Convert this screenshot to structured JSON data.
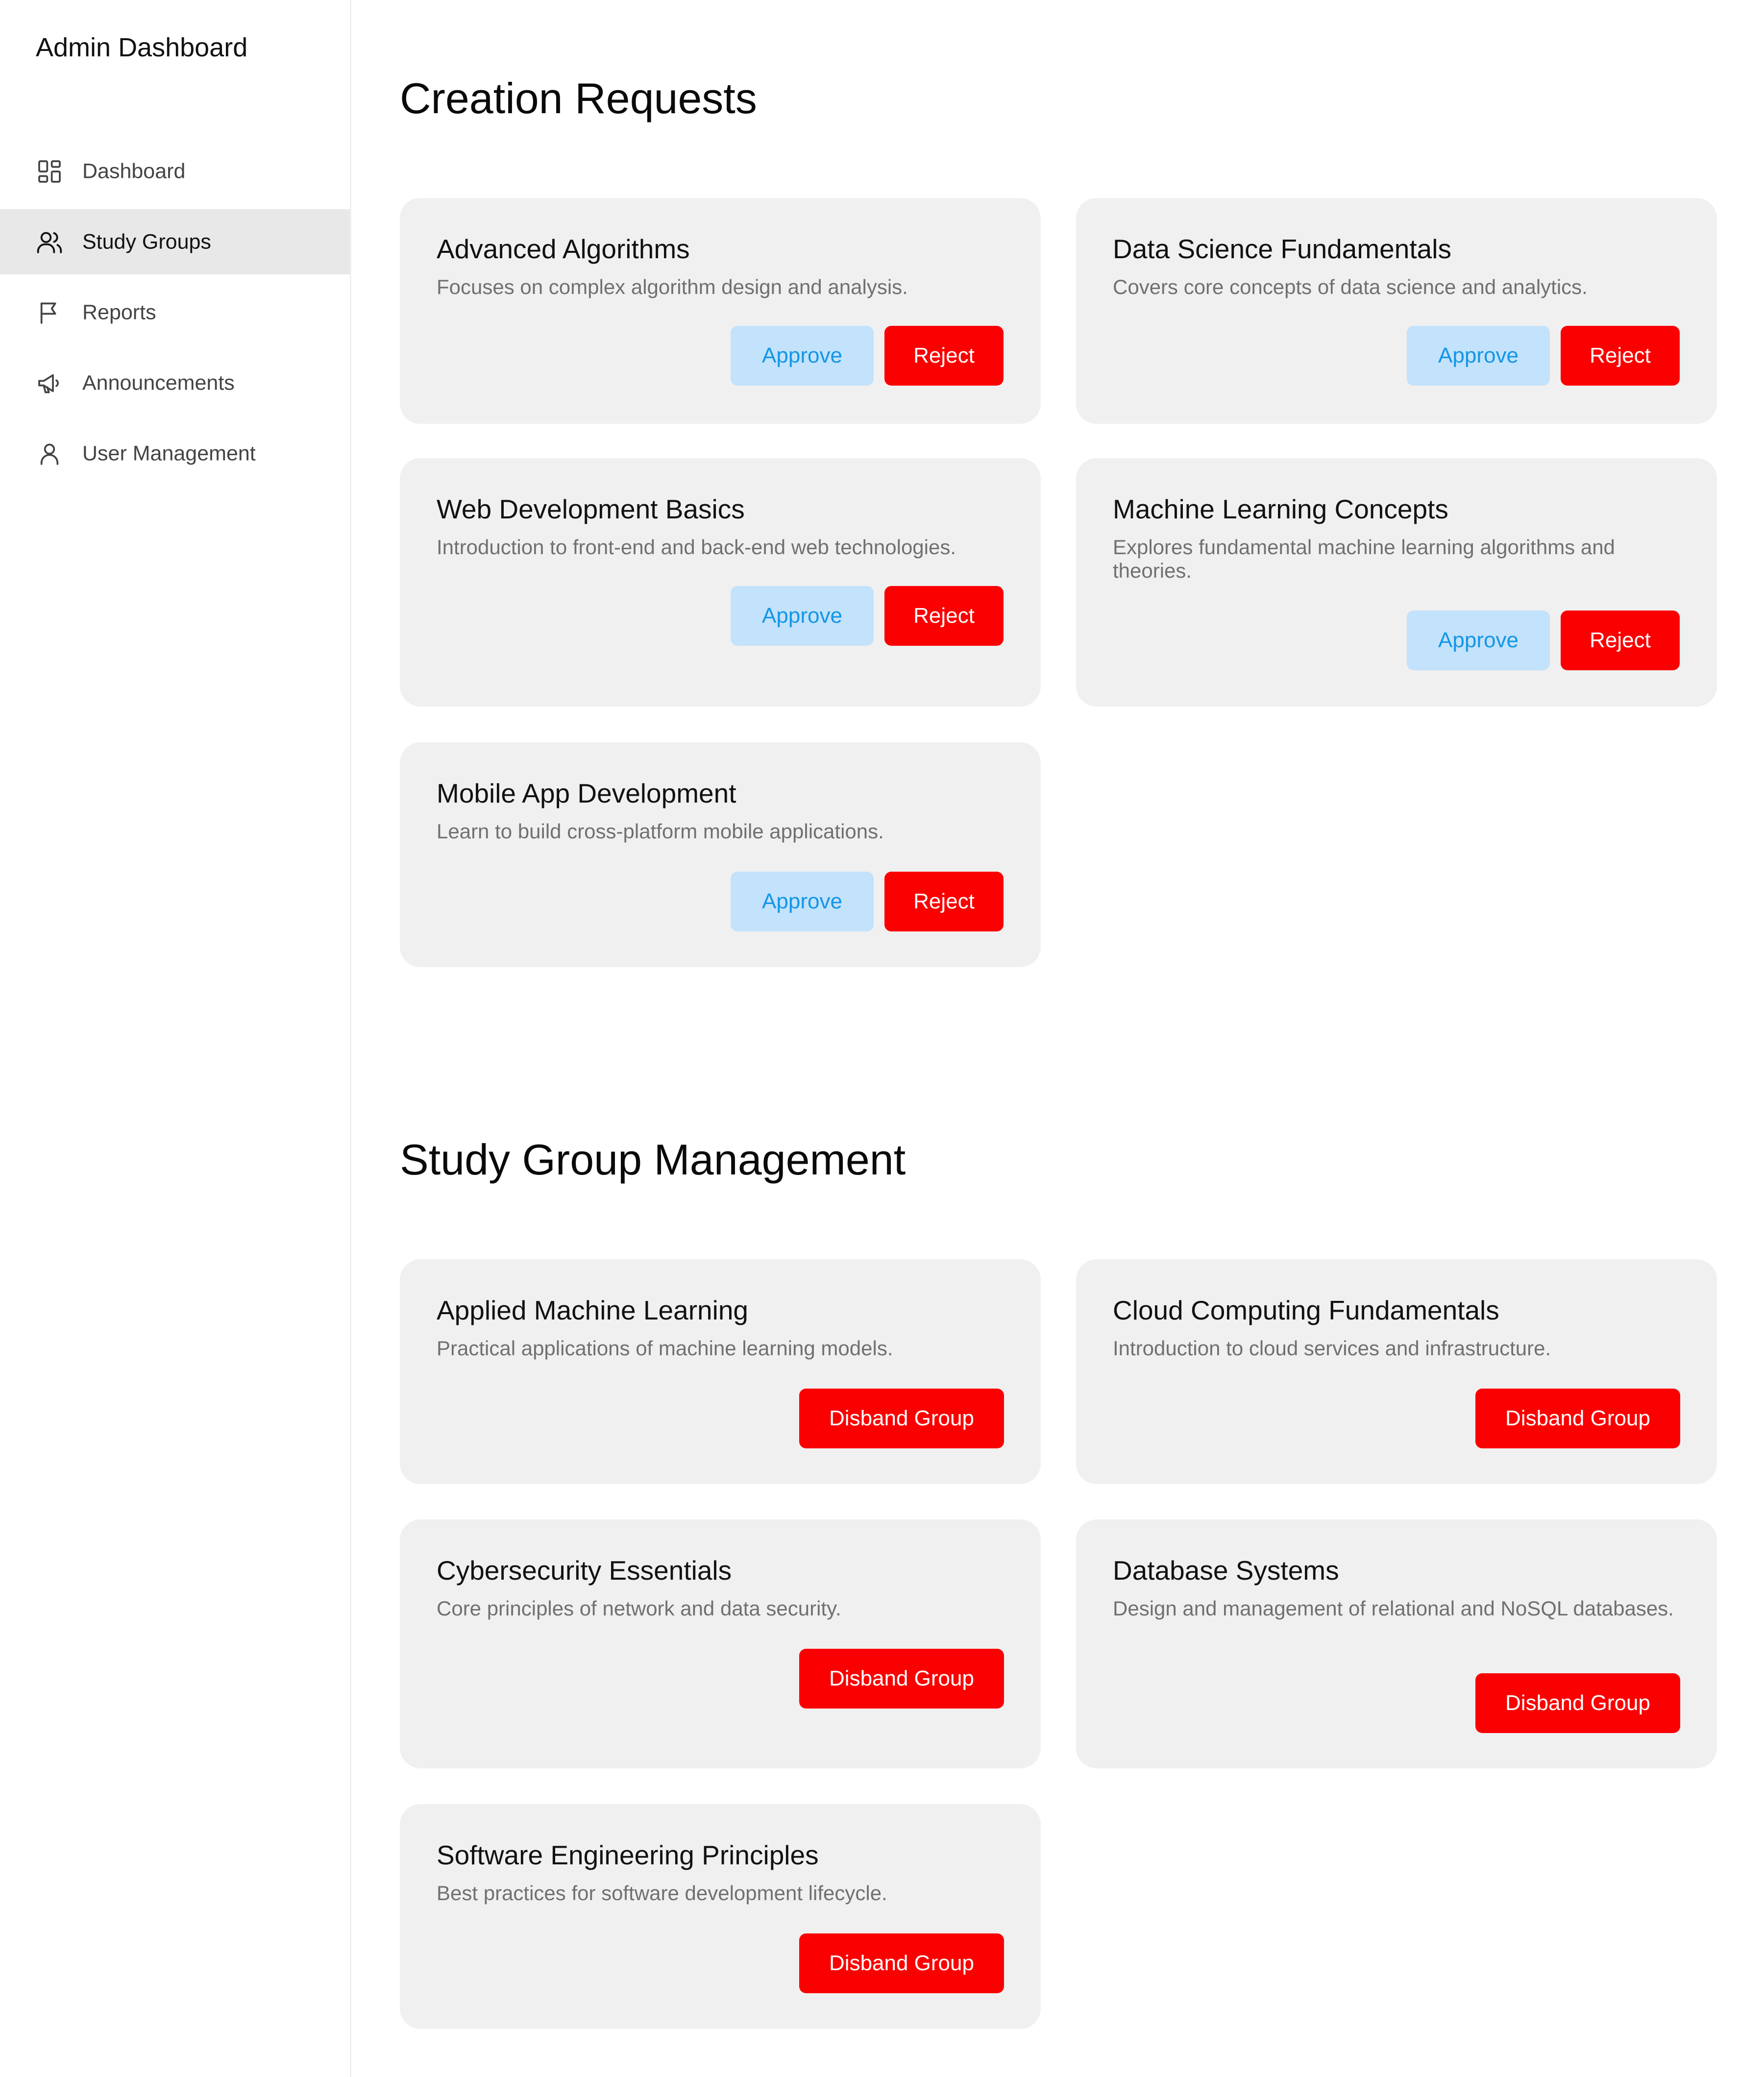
{
  "sidebar": {
    "title": "Admin Dashboard",
    "items": [
      {
        "label": "Dashboard",
        "icon": "dashboard-icon"
      },
      {
        "label": "Study Groups",
        "icon": "users-icon",
        "active": true
      },
      {
        "label": "Reports",
        "icon": "flag-icon"
      },
      {
        "label": "Announcements",
        "icon": "megaphone-icon"
      },
      {
        "label": "User Management",
        "icon": "user-icon"
      }
    ]
  },
  "creation_requests": {
    "title": "Creation Requests",
    "approve_label": "Approve",
    "reject_label": "Reject",
    "cards": [
      {
        "title": "Advanced Algorithms",
        "description": "Focuses on complex algorithm design and analysis."
      },
      {
        "title": "Data Science Fundamentals",
        "description": "Covers core concepts of data science and analytics."
      },
      {
        "title": "Web Development Basics",
        "description": "Introduction to front-end and back-end web technologies."
      },
      {
        "title": "Machine Learning Concepts",
        "description": "Explores fundamental machine learning algorithms and theories."
      },
      {
        "title": "Mobile App Development",
        "description": "Learn to build cross-platform mobile applications."
      }
    ]
  },
  "management": {
    "title": "Study Group Management",
    "disband_label": "Disband Group",
    "cards": [
      {
        "title": "Applied Machine Learning",
        "description": "Practical applications of machine learning models."
      },
      {
        "title": "Cloud Computing Fundamentals",
        "description": "Introduction to cloud services and infrastructure."
      },
      {
        "title": "Cybersecurity Essentials",
        "description": "Core principles of network and data security."
      },
      {
        "title": "Database Systems",
        "description": "Design and management of relational and NoSQL databases."
      },
      {
        "title": "Software Engineering Principles",
        "description": "Best practices for software development lifecycle."
      }
    ]
  },
  "colors": {
    "approve_bg": "#c3e2fb",
    "approve_text": "#1396e6",
    "danger": "#fb0000",
    "card_bg": "#f0f0f0",
    "active_nav_bg": "#e8e8e8"
  }
}
